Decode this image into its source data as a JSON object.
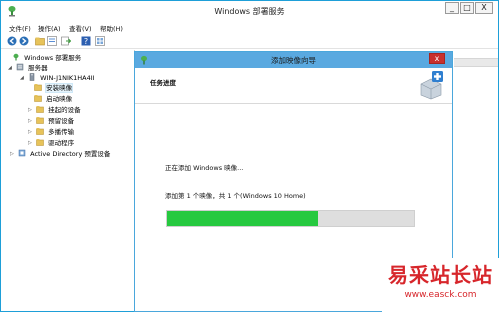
{
  "window": {
    "title": "Windows 部署服务",
    "min_label": "_",
    "max_label": "□",
    "close_label": "X"
  },
  "menu": [
    "文件(F)",
    "操作(A)",
    "查看(V)",
    "帮助(H)"
  ],
  "toolbar": {
    "icons": [
      "back-arrow-icon",
      "forward-arrow-icon",
      "folder-icon",
      "properties-icon",
      "export-icon",
      "help-icon",
      "view-icon"
    ]
  },
  "tree": {
    "items": [
      {
        "label": "Windows 部署服务",
        "level": 0,
        "expander": "",
        "icon": "server-icon"
      },
      {
        "label": "服务器",
        "level": 1,
        "expander": "◢",
        "icon": "server-group-icon"
      },
      {
        "label": "WIN-J1NIK1HA4II",
        "level": 2,
        "expander": "◢",
        "icon": "computer-icon"
      },
      {
        "label": "安装映像",
        "level": 3,
        "expander": "",
        "icon": "folder-icon",
        "selected": true
      },
      {
        "label": "启动映像",
        "level": 3,
        "expander": "",
        "icon": "folder-icon"
      },
      {
        "label": "挂起的设备",
        "level": 3,
        "expander": "▷",
        "icon": "folder-icon"
      },
      {
        "label": "预留设备",
        "level": 3,
        "expander": "▷",
        "icon": "folder-icon"
      },
      {
        "label": "多播传输",
        "level": 3,
        "expander": "▷",
        "icon": "folder-icon"
      },
      {
        "label": "驱动程序",
        "level": 3,
        "expander": "▷",
        "icon": "folder-icon"
      },
      {
        "label": "Active Directory 预置设备",
        "level": 1,
        "expander": "▷",
        "icon": "directory-icon"
      }
    ]
  },
  "wizard": {
    "title": "添加映像向导",
    "close_label": "x",
    "step_title": "任务进度",
    "status": "正在添加 Windows 映像...",
    "detail": "添加第 1 个映像，共 1 个(Windows 10 Home)",
    "progress": 0.61
  },
  "watermark": {
    "text": "易采站长站",
    "url": "www.easck.com"
  },
  "colors": {
    "accent": "#1e9fd8",
    "wizard_title_bg": "#5aa9e0",
    "progress": "#26c93f",
    "close_red": "#c9302c",
    "watermark": "#d7262b"
  }
}
